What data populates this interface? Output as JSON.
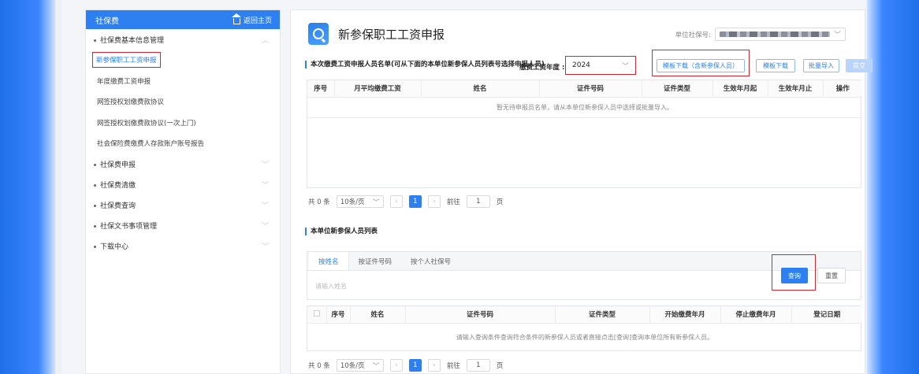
{
  "sidebar": {
    "header": "社保费",
    "home_link": "返回主页",
    "groups": [
      {
        "label": "社保费基本信息管理",
        "chevron": "︿"
      },
      {
        "label": "社保费申报",
        "chevron": "﹀"
      },
      {
        "label": "社保费清缴",
        "chevron": "﹀"
      },
      {
        "label": "社保费查询",
        "chevron": "﹀"
      },
      {
        "label": "社保文书事项管理",
        "chevron": "﹀"
      },
      {
        "label": "下载中心",
        "chevron": "﹀"
      }
    ],
    "subitems": [
      "新参保职工工资申报",
      "年度缴费工资申报",
      "网签授权划缴费款协议",
      "网签授权划缴费款协议(一次上门)",
      "社会保险费缴费人存款账户账号报告"
    ]
  },
  "main": {
    "title": "新参保职工工资申报",
    "unit_label": "单位社保号:",
    "section1": "本次缴费工资申报人员名单(可从下面的本单位新参保人员列表号选择申报人员)",
    "year_label": "缴费工资年度 :",
    "year_value": "2024",
    "buttons": {
      "template_new": "模板下载（含新参保人员）",
      "template": "模板下载",
      "batch_import": "批量导入",
      "submit": "提交"
    },
    "table1": {
      "headers": [
        "序号",
        "月平均缴费工资",
        "姓名",
        "证件号码",
        "证件类型",
        "生效年月起",
        "生效年月止",
        "操作"
      ],
      "empty": "暂无待申报员名单，请从本单位新参保人员中选择或批量导入。"
    },
    "pager1": {
      "total": "共 0 条",
      "size": "10条/页",
      "page": "1",
      "goto": "前往",
      "goto_val": "1",
      "page_unit": "页"
    },
    "section2": "本单位新参保人员列表",
    "tabs": [
      "按姓名",
      "按证件号码",
      "按个人社保号"
    ],
    "search_placeholder": "请输入姓名",
    "search_btn": "查询",
    "reset_btn": "重置",
    "table2": {
      "headers": [
        "序号",
        "姓名",
        "证件号码",
        "证件类型",
        "开始缴费年月",
        "停止缴费年月",
        "登记日期"
      ],
      "empty": "请输入查询条件查询符合条件的新参保人员或者直接点击[查询]查询本单位所有新参保人员。"
    },
    "pager2": {
      "total": "共 0 条",
      "size": "10条/页",
      "page": "1",
      "goto": "前往",
      "goto_val": "1",
      "page_unit": "页"
    }
  }
}
